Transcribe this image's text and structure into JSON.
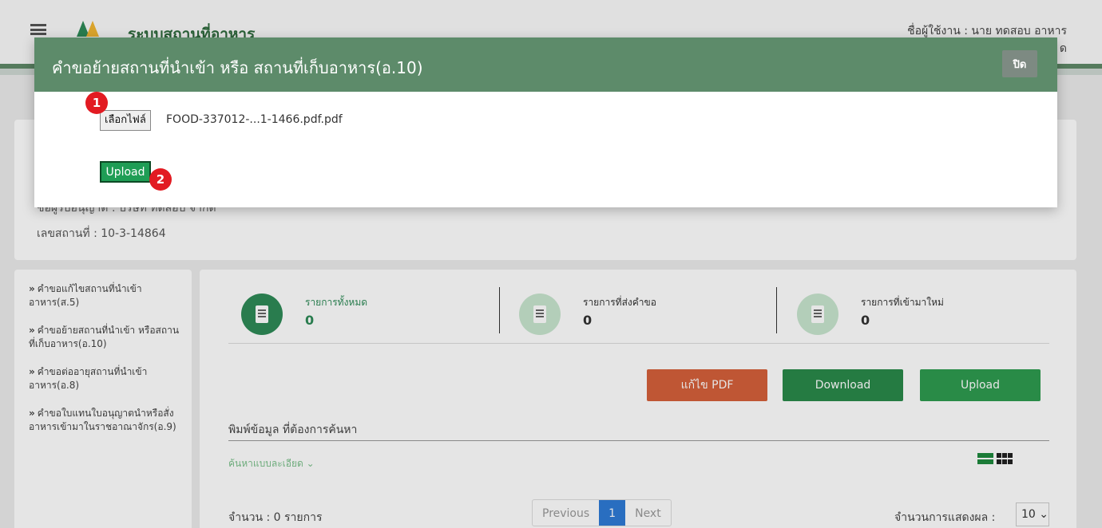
{
  "header": {
    "app_title": "ระบบสถานที่อาหาร",
    "user_label": "ชื่อผู้ใช้งาน : นาย ทดสอบ อาหาร",
    "user_line2": "ด"
  },
  "info": {
    "obscured_line": "ชื่อผู้รับอนุญาต : บริษัท ทดสอบ จำกัด",
    "place_no": "เลขสถานที่ :  10-3-14864"
  },
  "sidebar": {
    "items": [
      {
        "label": "คำขอแก้ไขสถานที่นำเข้าอาหาร(ส.5)"
      },
      {
        "label": "คำขอย้ายสถานที่นำเข้า หรือสถานที่เก็บอาหาร(อ.10)"
      },
      {
        "label": "คำขอต่ออายุสถานที่นำเข้าอาหาร(อ.8)"
      },
      {
        "label": "คำขอใบแทนใบอนุญาตนำหรือสั่งอาหารเข้ามาในราชอาณาจักร(อ.9)"
      }
    ]
  },
  "stats": [
    {
      "label": "รายการทั้งหมด",
      "value": "0",
      "color": "#2e8b57"
    },
    {
      "label": "รายการที่ส่งคำขอ",
      "value": "0",
      "color": "#c8e6cf"
    },
    {
      "label": "รายการที่เข้ามาใหม่",
      "value": "0",
      "color": "#c8e6cf"
    }
  ],
  "actions": {
    "edit_pdf": "แก้ไข PDF",
    "download": "Download",
    "upload": "Upload"
  },
  "search": {
    "label": "พิมพ์ข้อมูล ที่ต้องการค้นหา",
    "advanced": "ค้นหาแบบละเอียด ⌄"
  },
  "list": {
    "count": "จำนวน : 0 รายการ",
    "pager": {
      "prev": "Previous",
      "page": "1",
      "next": "Next"
    },
    "per_page_label": "จำนวนการแสดงผล :",
    "per_page_value": "10 ⌄"
  },
  "modal": {
    "title": "คำขอย้ายสถานที่นำเข้า หรือ สถานที่เก็บอาหาร(อ.10)",
    "close": "ปิด",
    "choose_file": "เลือกไฟล์",
    "file_name": "FOOD-337012-...1-1466.pdf.pdf",
    "upload": "Upload",
    "badge1": "1",
    "badge2": "2"
  },
  "colors": {
    "header_green": "#5d8b6a",
    "edit_pdf": "#d5603a",
    "download": "#2a8a4a",
    "upload": "#2e9b50",
    "badge": "#e21b22"
  }
}
